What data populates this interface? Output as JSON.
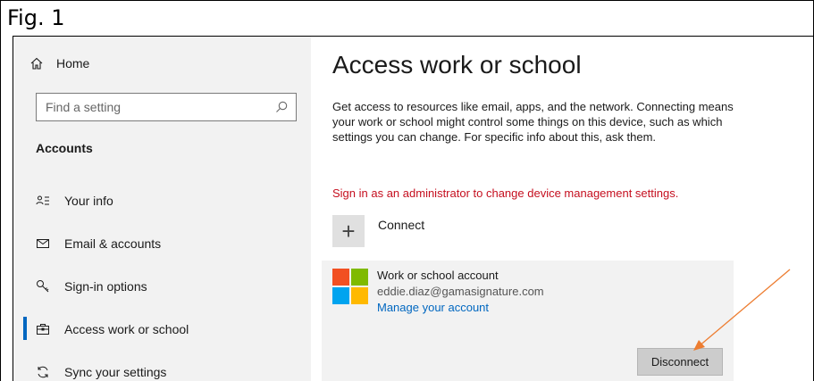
{
  "figure_label": "Fig. 1",
  "sidebar": {
    "home_label": "Home",
    "search_placeholder": "Find a setting",
    "section_title": "Accounts",
    "items": [
      {
        "label": "Your info",
        "icon": "person-list-icon"
      },
      {
        "label": "Email & accounts",
        "icon": "mail-icon"
      },
      {
        "label": "Sign-in options",
        "icon": "key-icon"
      },
      {
        "label": "Access work or school",
        "icon": "briefcase-icon",
        "active": true
      },
      {
        "label": "Sync your settings",
        "icon": "sync-icon"
      }
    ]
  },
  "main": {
    "title": "Access work or school",
    "description": "Get access to resources like email, apps, and the network. Connecting means your work or school might control some things on this device, such as which settings you can change. For specific info about this, ask them.",
    "warning": "Sign in as an administrator to change device management settings.",
    "connect_label": "Connect",
    "account": {
      "type": "Work or school account",
      "email": "eddie.diaz@gamasignature.com",
      "manage_link": "Manage your account",
      "disconnect_label": "Disconnect"
    }
  },
  "colors": {
    "accent": "#0067c0",
    "warning": "#c50f1f",
    "annotation_arrow": "#ed7d31",
    "ms_red": "#f25022",
    "ms_green": "#7fba00",
    "ms_blue": "#00a4ef",
    "ms_yellow": "#ffb900"
  }
}
